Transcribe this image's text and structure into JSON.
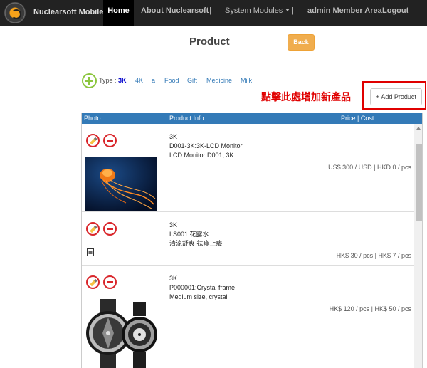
{
  "navbar": {
    "brand": "Nuclearsoft Mobile ERP",
    "home": "Home",
    "about": "About Nuclearsoft",
    "sep1": "|",
    "system_modules": "System Modules",
    "sep2": "|",
    "member_area": "admin Member Area",
    "sep3": "|",
    "logout": "Logout"
  },
  "page": {
    "title": "Product",
    "back": "Back"
  },
  "type_filter": {
    "label": "Type :",
    "items": [
      "3K",
      "4K",
      "a",
      "Food",
      "Gift",
      "Medicine",
      "Milk"
    ],
    "selected": "3K"
  },
  "annotation": "點擊此處增加新產品",
  "add_product": "+ Add Product",
  "table": {
    "headers": {
      "photo": "Photo",
      "info": "Product Info.",
      "price": "Price | Cost"
    },
    "rows": [
      {
        "type": "3K",
        "code": "D001-3K:3K-LCD Monitor",
        "desc": "LCD Monitor D001, 3K",
        "price": "US$  300 / USD | HKD  0 / pcs",
        "photo": "jellyfish"
      },
      {
        "type": "3K",
        "code": "LS001:花露水",
        "desc": "清涼舒爽 祛痱止癢",
        "price": "HK$  30 / pcs | HK$  7 / pcs",
        "photo": "broken-image-icon"
      },
      {
        "type": "3K",
        "code": "P000001:Crystal frame",
        "desc": "Medium size, crystal",
        "price": "HK$  120 / pcs | HK$  50 / pcs",
        "photo": "watches"
      }
    ]
  }
}
